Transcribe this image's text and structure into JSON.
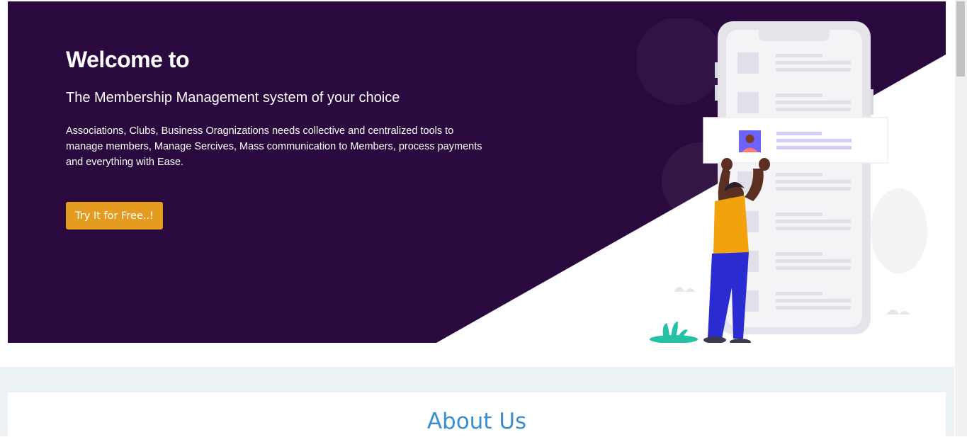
{
  "hero": {
    "title": "Welcome to",
    "subtitle": "The Membership Management system of your choice",
    "description": "Associations, Clubs, Business Oragnizations needs collective and centralized tools to manage members, Manage Sercives, Mass communication to Members, process payments and everything with Ease.",
    "cta_label": "Try It for Free..!"
  },
  "about": {
    "title": "About Us"
  },
  "colors": {
    "hero_background": "#2a0a3e",
    "cta": "#e39c1f",
    "about_title": "#3a8fd1",
    "section_background": "#edf2f5"
  },
  "icons": {
    "illustration": "person-holding-phone-card-illustration"
  }
}
